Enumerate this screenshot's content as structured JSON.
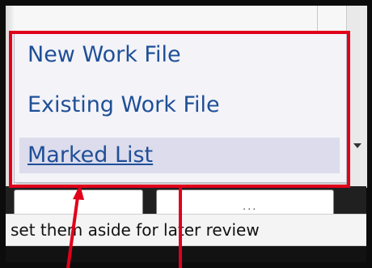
{
  "menu": {
    "items": [
      {
        "label": "New Work File"
      },
      {
        "label": "Existing Work File"
      },
      {
        "label": "Marked List"
      }
    ]
  },
  "hint": {
    "text": "set them aside for later review"
  },
  "partial_tab_label": "...",
  "colors": {
    "highlight": "#e0001a",
    "menu_text": "#1f4f96",
    "menu_background": "#f3f3f8",
    "active_item_background": "#dcdcec"
  }
}
